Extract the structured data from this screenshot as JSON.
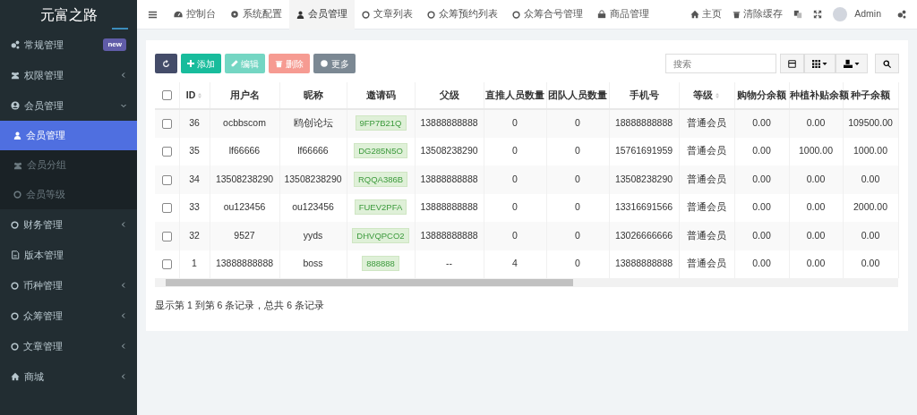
{
  "brand": "元富之路",
  "sidebar": {
    "items": [
      {
        "label": "常规管理",
        "kind": "badge",
        "badge": "new"
      },
      {
        "label": "权限管理",
        "kind": "group",
        "expanded": false
      },
      {
        "label": "会员管理",
        "kind": "group",
        "expanded": true,
        "children": [
          {
            "label": "会员管理",
            "selected": true
          },
          {
            "label": "会员分组",
            "selected": false
          },
          {
            "label": "会员等级",
            "selected": false
          }
        ]
      },
      {
        "label": "财务管理",
        "kind": "group",
        "expanded": false
      },
      {
        "label": "版本管理",
        "kind": "link"
      },
      {
        "label": "币种管理",
        "kind": "group",
        "expanded": false
      },
      {
        "label": "众筹管理",
        "kind": "group",
        "expanded": false
      },
      {
        "label": "文章管理",
        "kind": "group",
        "expanded": false
      },
      {
        "label": "商城",
        "kind": "group",
        "expanded": false
      }
    ]
  },
  "tabs": [
    {
      "label": "控制台",
      "selected": false
    },
    {
      "label": "系统配置",
      "selected": false
    },
    {
      "label": "会员管理",
      "selected": true
    },
    {
      "label": "文章列表",
      "selected": false
    },
    {
      "label": "众筹预约列表",
      "selected": false
    },
    {
      "label": "众筹合号管理",
      "selected": false
    },
    {
      "label": "商品管理",
      "selected": false
    }
  ],
  "top_right": {
    "home": "主页",
    "clear_cache": "清除缓存",
    "user": "Admin"
  },
  "toolbar": {
    "buttons": [
      {
        "kind": "refresh",
        "disabled": false
      },
      {
        "kind": "add",
        "label": "添加",
        "disabled": false
      },
      {
        "kind": "edit",
        "label": "编辑",
        "disabled": true
      },
      {
        "kind": "delete",
        "label": "删除",
        "disabled": true
      },
      {
        "kind": "more",
        "label": "更多",
        "disabled": false
      }
    ],
    "search": {
      "placeholder": "搜索"
    }
  },
  "table": {
    "select_all": {
      "checked": false
    },
    "columns": [
      {
        "label": "ID",
        "sortable": true
      },
      {
        "label": "用户名",
        "sortable": false
      },
      {
        "label": "昵称",
        "sortable": false
      },
      {
        "label": "邀请码",
        "sortable": false
      },
      {
        "label": "父级",
        "sortable": false
      },
      {
        "label": "直推人员数量",
        "sortable": false
      },
      {
        "label": "团队人员数量",
        "sortable": false
      },
      {
        "label": "手机号",
        "sortable": false
      },
      {
        "label": "等级",
        "sortable": true
      },
      {
        "label": "购物分余额",
        "sortable": false
      },
      {
        "label": "种植补贴余额",
        "sortable": false
      },
      {
        "label": "种子余额",
        "sortable": false
      }
    ],
    "rows": [
      {
        "checked": false,
        "cells": [
          "36",
          "ocbbscom",
          "鸥创论坛",
          "9FP7B21Q",
          "13888888888",
          "0",
          "0",
          "18888888888",
          "普通会员",
          "0.00",
          "0.00",
          "109500.00"
        ]
      },
      {
        "checked": false,
        "cells": [
          "35",
          "lf66666",
          "lf66666",
          "DG285N5O",
          "13508238290",
          "0",
          "0",
          "15761691959",
          "普通会员",
          "0.00",
          "1000.00",
          "1000.00"
        ]
      },
      {
        "checked": false,
        "cells": [
          "34",
          "13508238290",
          "13508238290",
          "RQQA386B",
          "13888888888",
          "0",
          "0",
          "13508238290",
          "普通会员",
          "0.00",
          "0.00",
          "0.00"
        ]
      },
      {
        "checked": false,
        "cells": [
          "33",
          "ou123456",
          "ou123456",
          "FUEV2PFA",
          "13888888888",
          "0",
          "0",
          "13316691566",
          "普通会员",
          "0.00",
          "0.00",
          "2000.00"
        ]
      },
      {
        "checked": false,
        "cells": [
          "32",
          "9527",
          "yyds",
          "DHVQPCO2",
          "13888888888",
          "0",
          "0",
          "13026666666",
          "普通会员",
          "0.00",
          "0.00",
          "0.00"
        ]
      },
      {
        "checked": false,
        "cells": [
          "1",
          "13888888888",
          "boss",
          "888888",
          "--",
          "4",
          "0",
          "13888888888",
          "普通会员",
          "0.00",
          "0.00",
          "0.00"
        ]
      }
    ]
  },
  "pagination": {
    "summary": "显示第 1 到第 6 条记录，总共 6 条记录"
  }
}
